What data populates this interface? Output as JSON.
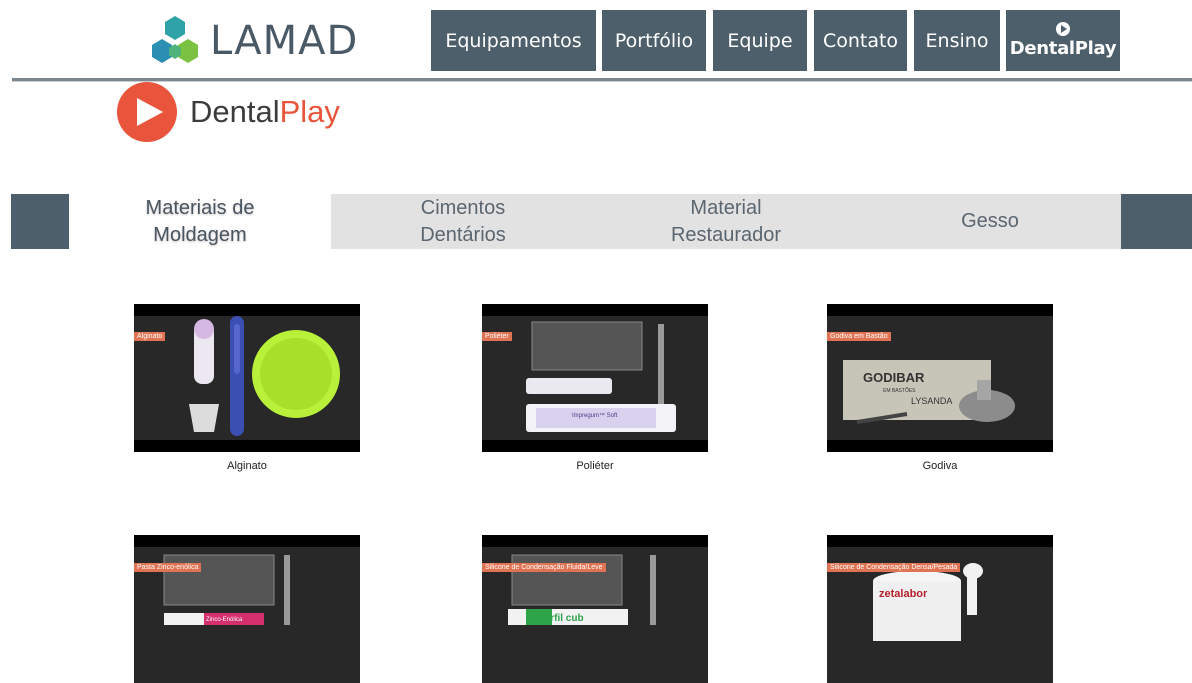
{
  "brand": {
    "name": "LAMAD"
  },
  "nav": {
    "items": [
      "Equipamentos",
      "Portfólio",
      "Equipe",
      "Contato",
      "Ensino"
    ],
    "dentalplay_label": "DentalPlay"
  },
  "hero": {
    "brand_prefix": "Dental",
    "brand_suffix": "Play"
  },
  "categories": [
    {
      "line1": "Materiais de",
      "line2": "Moldagem"
    },
    {
      "line1": "Cimentos",
      "line2": "Dentários"
    },
    {
      "line1": "Material",
      "line2": "Restaurador"
    },
    {
      "line1": "Gesso",
      "line2": ""
    }
  ],
  "videos": [
    {
      "tag": "Alginato",
      "caption": "Alginato"
    },
    {
      "tag": "Poliéter",
      "caption": "Poliéter"
    },
    {
      "tag": "Godiva em Bastão",
      "caption": "Godiva"
    },
    {
      "tag": "Pasta Zinco-enólica",
      "caption": ""
    },
    {
      "tag": "Silicone de Condensação Fluida/Leve",
      "caption": ""
    },
    {
      "tag": "Silicone de Condensação Densa/Pesada",
      "caption": ""
    }
  ],
  "product_labels": {
    "impregum": "Impregum™ Soft",
    "godibar": "GODIBAR",
    "godibar_sub": "EM BASTÕES",
    "lysanda": "LYSANDA",
    "zinco": "Zinco-Enólica",
    "perfil": "Perfil cub",
    "zetalabor": "zetalabor"
  },
  "colors": {
    "nav_bg": "#4e5f6c",
    "accent": "#e8543c",
    "tab_bg": "#e2e2e2"
  }
}
